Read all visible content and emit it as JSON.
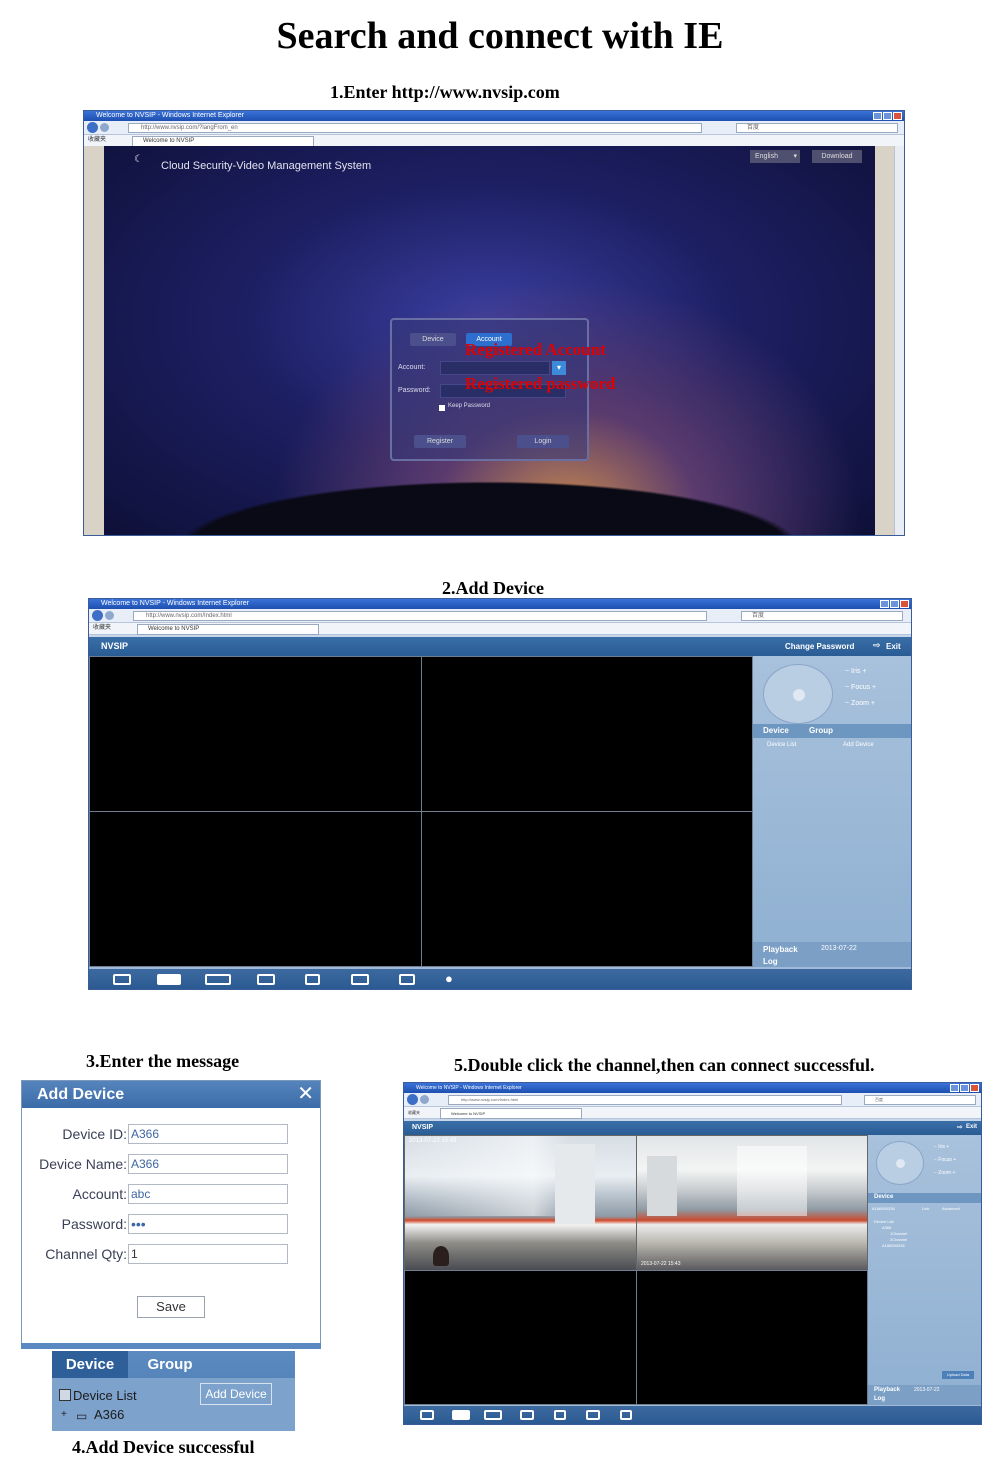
{
  "main_title": "Search and connect with IE",
  "steps": {
    "s1": "1.Enter http://www.nvsip.com",
    "s2": "2.Add Device",
    "s3": "3.Enter the message",
    "s4": "4.Add Device successful",
    "s5": "5.Double click the channel,then can connect successful."
  },
  "browser": {
    "title_login": "Welcome to NVSIP - Windows Internet Explorer",
    "address_login": "http://www.nvsip.com/?langFrom_en",
    "tab_title": "Welcome to NVSIP",
    "favorites": "收藏夹",
    "title_app": "Welcome to NVSIP - Windows Internet Explorer",
    "address_app": "http://www.nvsip.com/Index.html",
    "search_placeholder": "百度"
  },
  "login_page": {
    "system_title": "Cloud Security-Video Management System",
    "language": "English",
    "download": "Download",
    "tab_device": "Device",
    "tab_account": "Account",
    "account_label": "Account:",
    "password_label": "Password:",
    "keep_password": "Keep Password",
    "register": "Register",
    "login": "Login",
    "annotation_account": "Registered Account",
    "annotation_password": "Registered password"
  },
  "app_page": {
    "logo": "NVSIP",
    "change_password": "Change Password",
    "exit": "Exit",
    "iris": "Iris",
    "focus": "Focus",
    "zoom": "Zoom",
    "tab_device": "Device",
    "tab_group": "Group",
    "device_list": "Device List",
    "add_device": "Add Device",
    "playback": "Playback",
    "playback_date": "2013-07-22",
    "log": "Log"
  },
  "add_dialog": {
    "title": "Add Device",
    "fields": [
      {
        "label": "Device ID:",
        "value": "A366"
      },
      {
        "label": "Device Name:",
        "value": "A366"
      },
      {
        "label": "Account:",
        "value": "abc"
      },
      {
        "label": "Password:",
        "value": "•••"
      },
      {
        "label": "Channel Qty:",
        "value": "1"
      }
    ],
    "save": "Save"
  },
  "device_panel": {
    "tab_device": "Device",
    "tab_group": "Group",
    "device_list": "Device List",
    "add_device": "Add Device",
    "device_item": "A366"
  },
  "connected_page": {
    "logo": "NVSIP",
    "exit": "Exit",
    "tab_device": "Device",
    "device_id": "A186500336",
    "link": "Link",
    "advanced": "Advanced",
    "device_list": "Device List",
    "device_item": "A366",
    "channel1": "1Channel",
    "channel2": "2Channel",
    "device_item2": "A186500336",
    "upload_data": "Upload Data",
    "playback": "Playback",
    "playback_date": "2013-07-22",
    "log": "Log",
    "cam_timestamp1": "2013-07-22 15:43",
    "cam_timestamp2": "2013-07-22 15:43"
  },
  "icons": {
    "exit": "exit-icon",
    "ptz": "ptz-joystick-icon",
    "toolbar": [
      "close-video-icon",
      "record-icon",
      "close-all-icon",
      "split-screen-icon",
      "playback-icon",
      "snapshot-icon",
      "fullscreen-icon",
      "user-icon"
    ]
  },
  "colors": {
    "annotation_red": "#e00000",
    "nvsip_header": "#2a5c94",
    "dialog_header": "#3c6ca8"
  }
}
